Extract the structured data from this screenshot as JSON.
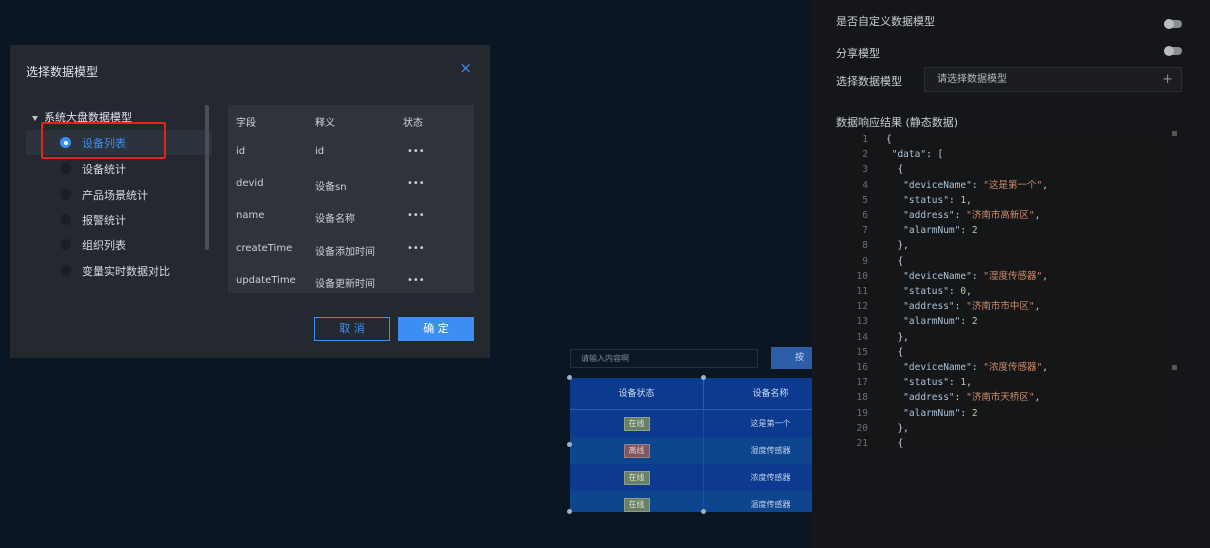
{
  "right_panel": {
    "custom_model_label": "是否自定义数据模型",
    "share_model_label": "分享模型",
    "select_model_label": "选择数据模型",
    "select_model_placeholder": "请选择数据模型",
    "select_plus": "+",
    "response_label": "数据响应结果 (静态数据)",
    "code_lines": [
      {
        "n": "1",
        "t": "{"
      },
      {
        "n": "2",
        "t": " \"data\": ["
      },
      {
        "n": "3",
        "t": "  {"
      },
      {
        "n": "4",
        "t": "   \"deviceName\": \"这是第一个\","
      },
      {
        "n": "5",
        "t": "   \"status\": 1,"
      },
      {
        "n": "6",
        "t": "   \"address\": \"济南市高新区\","
      },
      {
        "n": "7",
        "t": "   \"alarmNum\": 2"
      },
      {
        "n": "8",
        "t": "  },"
      },
      {
        "n": "9",
        "t": "  {"
      },
      {
        "n": "10",
        "t": "   \"deviceName\": \"湿度传感器\","
      },
      {
        "n": "11",
        "t": "   \"status\": 0,"
      },
      {
        "n": "12",
        "t": "   \"address\": \"济南市市中区\","
      },
      {
        "n": "13",
        "t": "   \"alarmNum\": 2"
      },
      {
        "n": "14",
        "t": "  },"
      },
      {
        "n": "15",
        "t": "  {"
      },
      {
        "n": "16",
        "t": "   \"deviceName\": \"浓度传感器\","
      },
      {
        "n": "17",
        "t": "   \"status\": 1,"
      },
      {
        "n": "18",
        "t": "   \"address\": \"济南市天桥区\","
      },
      {
        "n": "19",
        "t": "   \"alarmNum\": 2"
      },
      {
        "n": "20",
        "t": "  },"
      },
      {
        "n": "21",
        "t": "  {"
      }
    ]
  },
  "preview": {
    "search_placeholder": "请输入内容啊",
    "search_button": "按钮",
    "columns": [
      "设备状态",
      "设备名称"
    ],
    "rows": [
      {
        "status": "在线",
        "online": true,
        "name": "这是第一个"
      },
      {
        "status": "离线",
        "online": false,
        "name": "湿度传感器"
      },
      {
        "status": "在线",
        "online": true,
        "name": "浓度传感器"
      },
      {
        "status": "在线",
        "online": true,
        "name": "温度传感器"
      }
    ]
  },
  "modal": {
    "title": "选择数据模型",
    "close": "×",
    "tree_root": "系统大盘数据模型",
    "tree_items": [
      {
        "label": "设备列表",
        "selected": true
      },
      {
        "label": "设备统计",
        "selected": false
      },
      {
        "label": "产品场景统计",
        "selected": false
      },
      {
        "label": "报警统计",
        "selected": false
      },
      {
        "label": "组织列表",
        "selected": false
      },
      {
        "label": "变量实时数据对比",
        "selected": false
      }
    ],
    "field_headers": [
      "字段",
      "释义",
      "状态"
    ],
    "fields": [
      {
        "field": "id",
        "desc": "id",
        "status": "•••"
      },
      {
        "field": "devid",
        "desc": "设备sn",
        "status": "•••"
      },
      {
        "field": "name",
        "desc": "设备名称",
        "status": "•••"
      },
      {
        "field": "createTime",
        "desc": "设备添加时间",
        "status": "•••"
      },
      {
        "field": "updateTime",
        "desc": "设备更新时间",
        "status": "•••"
      }
    ],
    "cancel_label": "取 消",
    "ok_label": "确 定"
  },
  "colors": {
    "accent": "#3b8ef2",
    "highlight": "#e0251f",
    "table_bg": "#0b3a8e"
  }
}
